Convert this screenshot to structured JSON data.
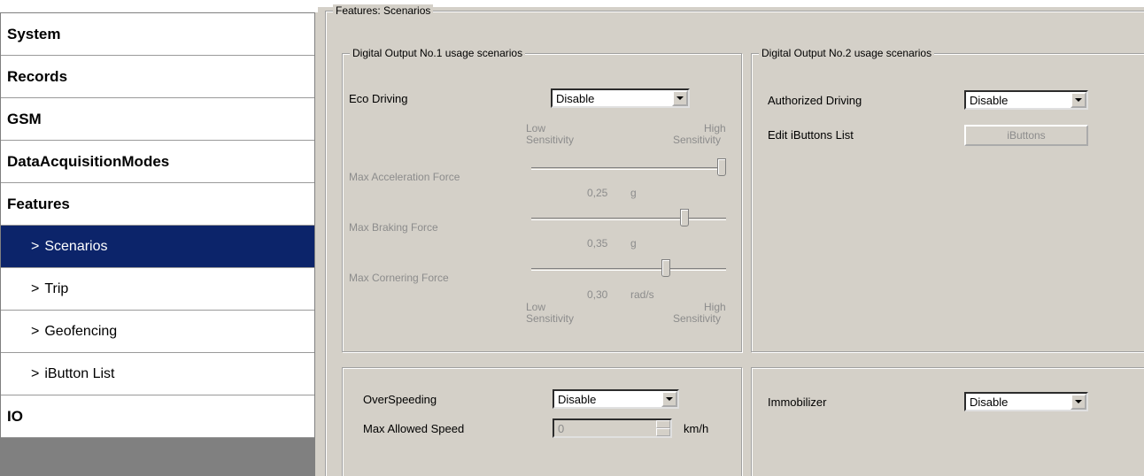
{
  "sidebar": {
    "items": [
      {
        "label": "System"
      },
      {
        "label": "Records"
      },
      {
        "label": "GSM"
      },
      {
        "label": "DataAcquisitionModes"
      },
      {
        "label": "Features"
      },
      {
        "label": "Scenarios",
        "selected": true
      },
      {
        "label": "Trip"
      },
      {
        "label": "Geofencing"
      },
      {
        "label": "iButton List"
      },
      {
        "label": "IO"
      }
    ],
    "sub_arrow": ">"
  },
  "features_group": {
    "title": "Features: Scenarios"
  },
  "dout1": {
    "title": "Digital Output No.1 usage scenarios",
    "eco_label": "Eco Driving",
    "eco_value": "Disable",
    "low_top": "Low",
    "sens_top_left": "Sensitivity",
    "high_top": "High",
    "sens_top_right": "Sensitivity",
    "accel_label": "Max Acceleration Force",
    "accel_value": "0,25",
    "accel_unit": "g",
    "accel_level": 1.0,
    "brake_label": "Max Braking Force",
    "brake_value": "0,35",
    "brake_unit": "g",
    "brake_level": 0.8,
    "corner_label": "Max Cornering Force",
    "corner_value": "0,30",
    "corner_unit": "rad/s",
    "corner_level": 0.7,
    "low_bottom": "Low",
    "sens_bottom_left": "Sensitivity",
    "high_bottom": "High",
    "sens_bottom_right": "Sensitivity"
  },
  "dout2": {
    "title": "Digital Output No.2 usage scenarios",
    "auth_label": "Authorized Driving",
    "auth_value": "Disable",
    "ibuttons_label": "Edit iButtons List",
    "ibuttons_button": "iButtons"
  },
  "overspeed": {
    "label": "OverSpeeding",
    "value": "Disable",
    "max_label": "Max Allowed Speed",
    "max_value": "0",
    "unit": "km/h"
  },
  "immobilizer": {
    "label": "Immobilizer",
    "value": "Disable"
  }
}
